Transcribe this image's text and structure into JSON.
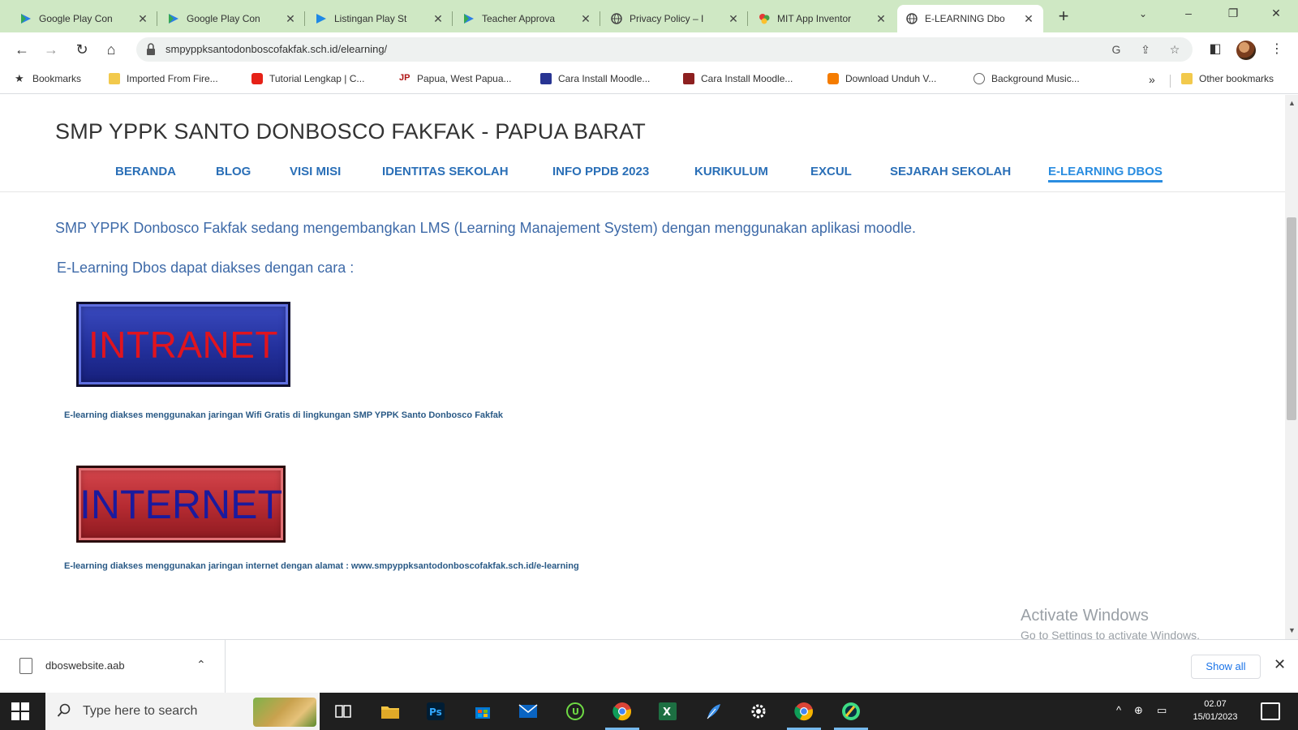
{
  "browser": {
    "tabs": [
      {
        "title": "Google Play Con",
        "icon": "play-console-icon"
      },
      {
        "title": "Google Play Con",
        "icon": "play-console-icon"
      },
      {
        "title": "Listingan Play St",
        "icon": "play-store-icon"
      },
      {
        "title": "Teacher Approva",
        "icon": "play-console-icon"
      },
      {
        "title": "Privacy Policy – I",
        "icon": "globe-icon"
      },
      {
        "title": "MIT App Inventor",
        "icon": "app-inventor-icon"
      },
      {
        "title": "E-LEARNING Dbo",
        "icon": "globe-icon",
        "active": true
      }
    ],
    "url": "smpyppksantodonboscofakfak.sch.id/elearning/",
    "bookmarks": [
      "Bookmarks",
      "Imported From Fire...",
      "Tutorial Lengkap | C...",
      "Papua, West Papua...",
      "Cara Install Moodle...",
      "Cara Install Moodle...",
      "Download Unduh V...",
      "Background Music..."
    ],
    "other_bookmarks": "Other bookmarks"
  },
  "site": {
    "title": "SMP YPPK SANTO DONBOSCO FAKFAK - PAPUA BARAT",
    "nav": [
      "BERANDA",
      "BLOG",
      "VISI MISI",
      "IDENTITAS SEKOLAH",
      "INFO PPDB 2023",
      "KURIKULUM",
      "EXCUL",
      "SEJARAH SEKOLAH",
      "E-LEARNING DBOS"
    ],
    "active_nav": "E-LEARNING DBOS",
    "intro": "SMP YPPK Donbosco Fakfak sedang mengembangkan LMS (Learning Manajement System) dengan menggunakan aplikasi moodle.",
    "access_label": "E-Learning Dbos dapat diakses dengan cara :",
    "intranet_button": "INTRANET",
    "intranet_caption": "E-learning diakses menggunakan jaringan Wifi Gratis di lingkungan SMP YPPK Santo Donbosco Fakfak",
    "internet_button": "INTERNET",
    "internet_caption": "E-learning diakses menggunakan jaringan internet dengan alamat : www.smpyppksantodonboscofakfak.sch.id/e-learning"
  },
  "watermark": {
    "line1": "Activate Windows",
    "line2": "Go to Settings to activate Windows."
  },
  "download_bar": {
    "file": "dboswebsite.aab",
    "show_all": "Show all"
  },
  "taskbar": {
    "search_placeholder": "Type here to search",
    "time": "02.07",
    "date": "15/01/2023"
  }
}
